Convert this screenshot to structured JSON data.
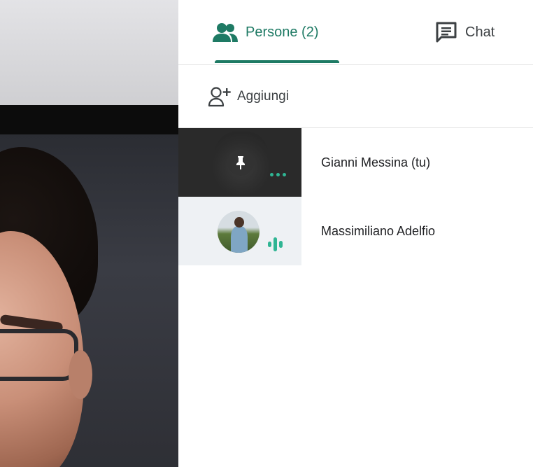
{
  "tabs": {
    "people_label": "Persone (2)",
    "chat_label": "Chat"
  },
  "add_label": "Aggiungi",
  "participants": [
    {
      "name": "Gianni Messina (tu)"
    },
    {
      "name": "Massimiliano Adelfio"
    }
  ],
  "icons": {
    "people": "people-icon",
    "chat": "chat-icon",
    "add_person": "add-person-icon",
    "pin": "pin-icon",
    "audio_dots": "audio-dots-icon",
    "audio_bars": "audio-level-icon"
  },
  "colors": {
    "accent": "#1e7a64",
    "audio": "#2fb593"
  }
}
